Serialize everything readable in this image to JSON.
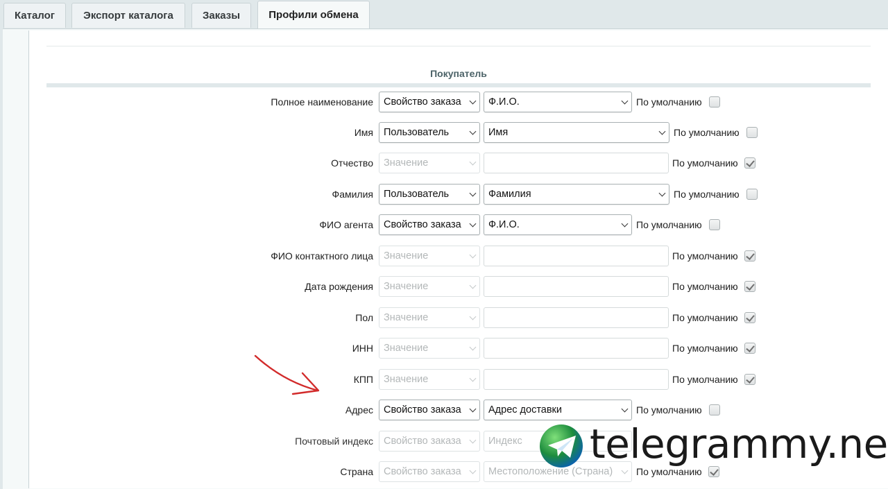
{
  "tabs": [
    {
      "label": "Каталог"
    },
    {
      "label": "Экспорт каталога"
    },
    {
      "label": "Заказы"
    },
    {
      "label": "Профили обмена"
    }
  ],
  "section": {
    "title": "Покупатель"
  },
  "rows": [
    {
      "label": "Полное наименование",
      "type": "Свойство заказа",
      "value": "Ф.И.О.",
      "default_label": "По умолчанию",
      "default_checked": false
    },
    {
      "label": "Имя",
      "type": "Пользователь",
      "value": "Имя",
      "default_label": "По умолчанию",
      "default_checked": false
    },
    {
      "label": "Отчество",
      "type": "Значение",
      "value": "",
      "default_label": "По умолчанию",
      "default_checked": true
    },
    {
      "label": "Фамилия",
      "type": "Пользователь",
      "value": "Фамилия",
      "default_label": "По умолчанию",
      "default_checked": false
    },
    {
      "label": "ФИО агента",
      "type": "Свойство заказа",
      "value": "Ф.И.О.",
      "default_label": "По умолчанию",
      "default_checked": false
    },
    {
      "label": "ФИО контактного лица",
      "type": "Значение",
      "value": "",
      "default_label": "По умолчанию",
      "default_checked": true
    },
    {
      "label": "Дата рождения",
      "type": "Значение",
      "value": "",
      "default_label": "По умолчанию",
      "default_checked": true
    },
    {
      "label": "Пол",
      "type": "Значение",
      "value": "",
      "default_label": "По умолчанию",
      "default_checked": true
    },
    {
      "label": "ИНН",
      "type": "Значение",
      "value": "",
      "default_label": "По умолчанию",
      "default_checked": true
    },
    {
      "label": "КПП",
      "type": "Значение",
      "value": "",
      "default_label": "По умолчанию",
      "default_checked": true
    },
    {
      "label": "Адрес",
      "type": "Свойство заказа",
      "value": "Адрес доставки",
      "default_label": "По умолчанию",
      "default_checked": false
    },
    {
      "label": "Почтовый индекс",
      "type": "Свойство заказа",
      "value": "Индекс",
      "default_label": "",
      "default_checked": false
    },
    {
      "label": "Страна",
      "type": "Свойство заказа",
      "value": "Местоположение (Страна)",
      "default_label": "По умолчанию",
      "default_checked": true
    }
  ],
  "watermark": {
    "text": "telegrammy.net"
  }
}
